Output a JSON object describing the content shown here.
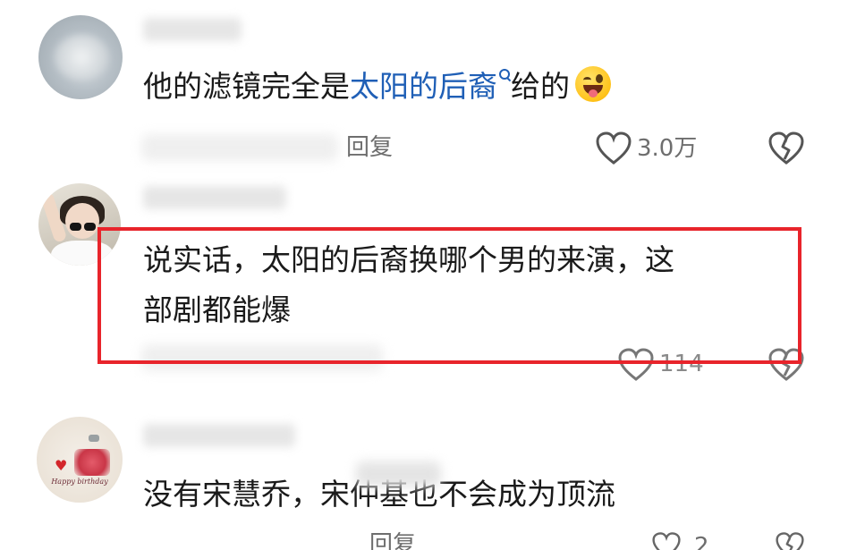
{
  "comments": [
    {
      "text_before": "他的滤镜完全是",
      "link_text": "太阳的后裔",
      "text_after": "给的",
      "reply_label": "回复",
      "like_count": "3.0万"
    },
    {
      "line1": "说实话，太阳的后裔换哪个男的来演，这",
      "line2": "部剧都能爆",
      "like_count": "114"
    },
    {
      "text": "没有宋慧乔，宋仲基也不会成为顶流",
      "reply_label": "回复",
      "like_count": "2"
    }
  ],
  "avatar3_caption": "Happy birthday",
  "icons": {
    "like": "heart-outline-icon",
    "dislike": "broken-heart-icon",
    "search": "search-icon",
    "emoji": "wink-tongue-emoji-icon"
  },
  "colors": {
    "highlight_border": "#e8242b",
    "link": "#1f5fb6",
    "meta": "#6e6e6e"
  }
}
